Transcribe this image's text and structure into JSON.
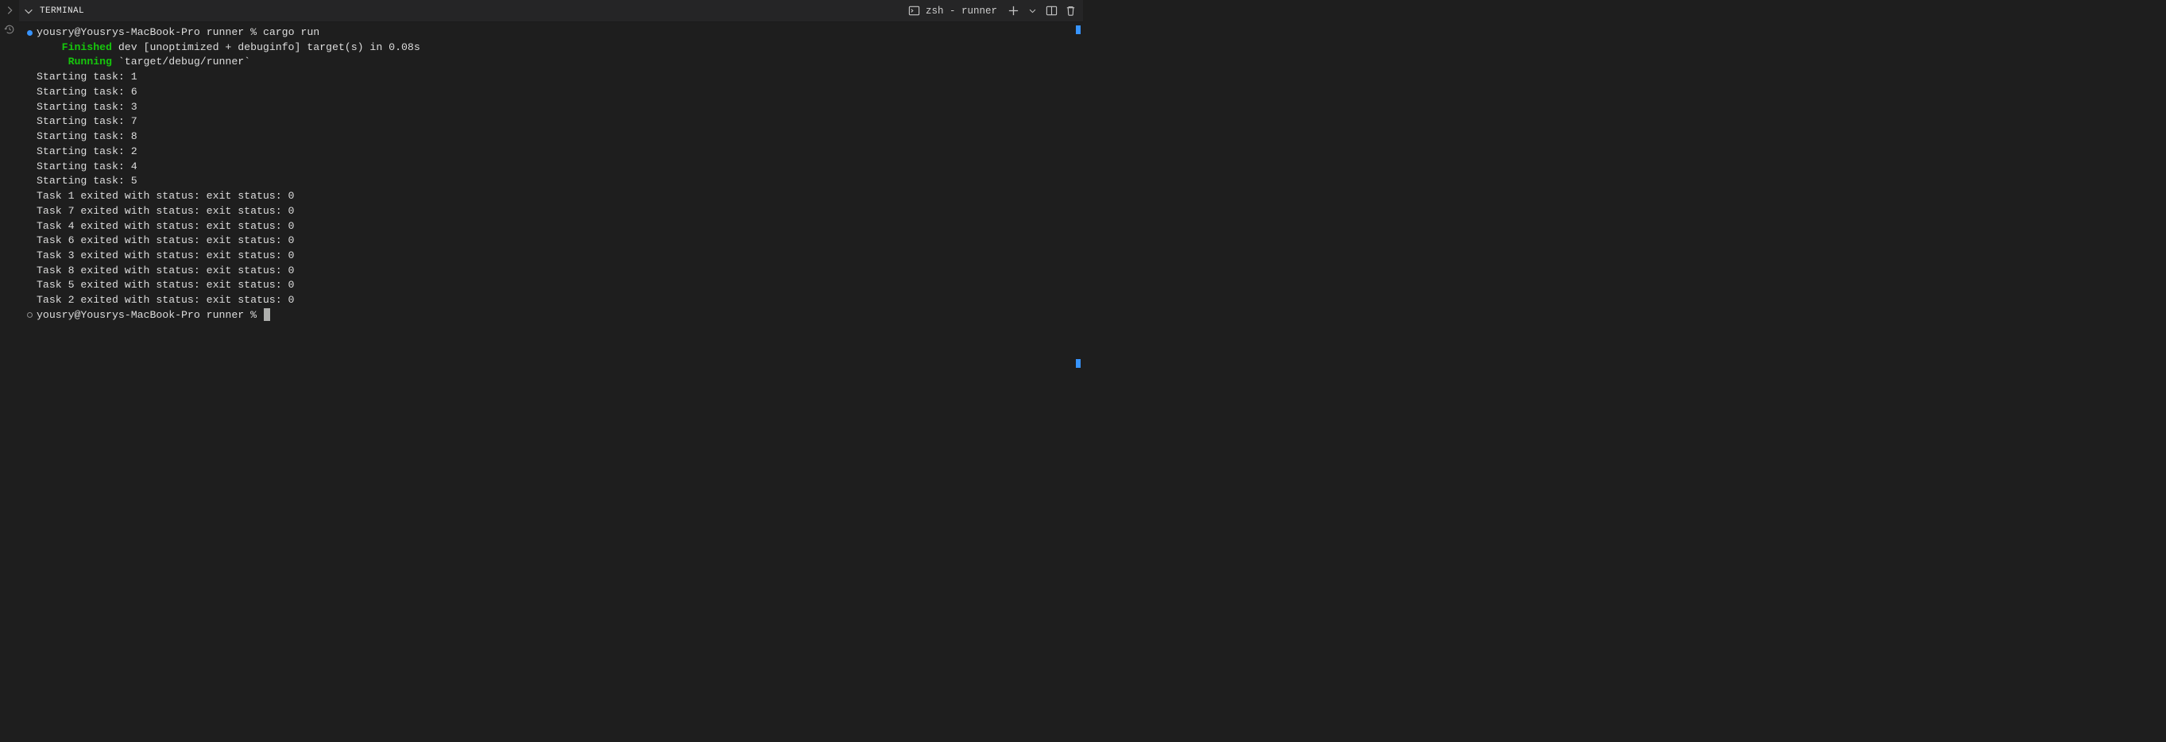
{
  "header": {
    "tab_label": "TERMINAL",
    "shell_label": "zsh - runner"
  },
  "terminal": {
    "prompt_user_host": "yousry@Yousrys-MacBook-Pro",
    "prompt_dir": "runner",
    "prompt_symbol": "%",
    "command": "cargo run",
    "finished_label": "Finished",
    "finished_rest": " dev [unoptimized + debuginfo] target(s) in 0.08s",
    "running_label": "Running",
    "running_rest": " `target/debug/runner`",
    "start_lines": [
      "Starting task: 1",
      "Starting task: 6",
      "Starting task: 3",
      "Starting task: 7",
      "Starting task: 8",
      "Starting task: 2",
      "Starting task: 4",
      "Starting task: 5"
    ],
    "exit_lines": [
      "Task 1 exited with status: exit status: 0",
      "Task 7 exited with status: exit status: 0",
      "Task 4 exited with status: exit status: 0",
      "Task 6 exited with status: exit status: 0",
      "Task 3 exited with status: exit status: 0",
      "Task 8 exited with status: exit status: 0",
      "Task 5 exited with status: exit status: 0",
      "Task 2 exited with status: exit status: 0"
    ],
    "second_prompt": "yousry@Yousrys-MacBook-Pro runner % "
  }
}
